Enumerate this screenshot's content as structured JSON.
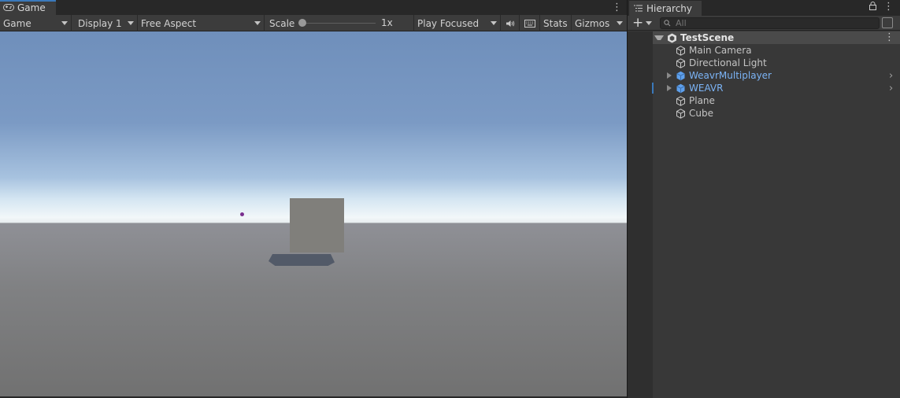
{
  "game": {
    "tab_label": "Game",
    "toolbar": {
      "view_mode": "Game",
      "display": "Display 1",
      "aspect": "Free Aspect",
      "scale_label": "Scale",
      "scale_value": "1x",
      "play_mode": "Play Focused",
      "stats_label": "Stats",
      "gizmos_label": "Gizmos"
    }
  },
  "hierarchy": {
    "tab_label": "Hierarchy",
    "search_placeholder": "All",
    "scene_name": "TestScene",
    "items": [
      {
        "label": "Main Camera",
        "type": "gameobject"
      },
      {
        "label": "Directional Light",
        "type": "gameobject"
      },
      {
        "label": "WeavrMultiplayer",
        "type": "prefab"
      },
      {
        "label": "WEAVR",
        "type": "prefab"
      },
      {
        "label": "Plane",
        "type": "gameobject"
      },
      {
        "label": "Cube",
        "type": "gameobject"
      }
    ]
  },
  "colors": {
    "panel_bg": "#383838",
    "toolbar_bg": "#3c3c3c",
    "accent": "#3a79bb",
    "prefab_text": "#7bb3f5"
  }
}
